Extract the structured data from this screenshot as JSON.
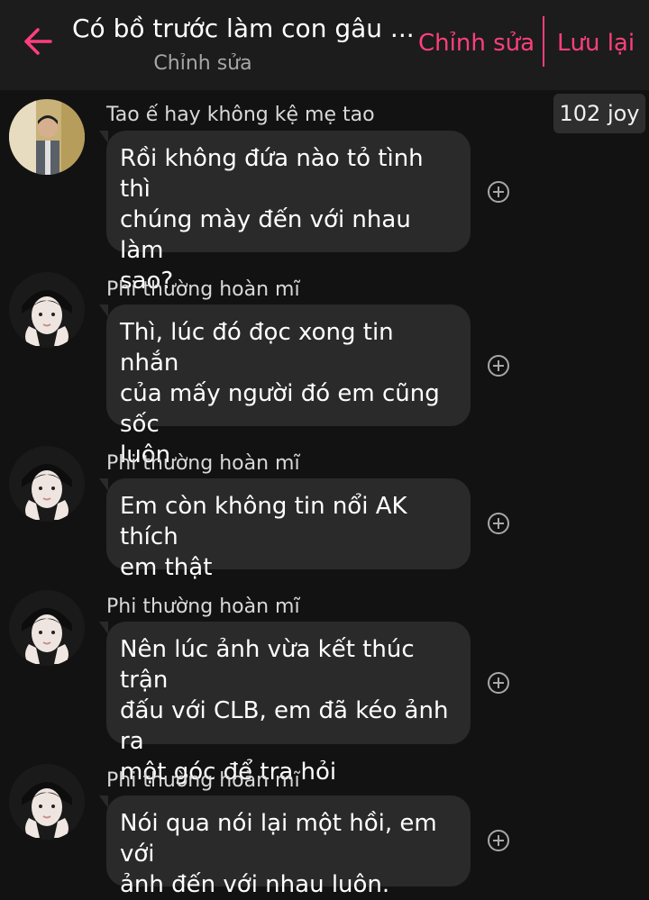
{
  "header": {
    "title": "Có bồ trước làm con gâu ...",
    "subtitle": "Chỉnh sửa",
    "edit_label": "Chỉnh sửa",
    "save_label": "Lưu lại"
  },
  "joy_badge": "102 joy",
  "colors": {
    "accent": "#ff3f7d",
    "background": "#121212",
    "header_bg": "#1c1c1c",
    "bubble_bg": "#2a2a2a"
  },
  "messages": [
    {
      "sender": "Tao ế hay không kệ mẹ tao",
      "avatar_icon": "man-in-suit-avatar-icon",
      "lines": [
        "Rồi không đứa nào tỏ tình thì",
        "chúng mày đến với nhau làm",
        "sao?"
      ]
    },
    {
      "sender": "Phi thường hoàn mĩ",
      "avatar_icon": "face-hands-avatar-icon",
      "lines": [
        "Thì, lúc đó đọc xong tin nhắn",
        "của mấy người đó em cũng sốc",
        "luôn"
      ]
    },
    {
      "sender": "Phi thường hoàn mĩ",
      "avatar_icon": "face-hands-avatar-icon",
      "lines": [
        "Em còn không tin nổi AK thích",
        "em thật"
      ]
    },
    {
      "sender": "Phi thường hoàn mĩ",
      "avatar_icon": "face-hands-avatar-icon",
      "lines": [
        "Nên lúc ảnh vừa kết thúc trận",
        "đấu với CLB, em đã kéo ảnh ra",
        "một góc để tra hỏi"
      ]
    },
    {
      "sender": "Phi thường hoàn mĩ",
      "avatar_icon": "face-hands-avatar-icon",
      "lines": [
        "Nói qua nói lại một hồi, em với",
        "ảnh đến với nhau luôn."
      ]
    }
  ]
}
